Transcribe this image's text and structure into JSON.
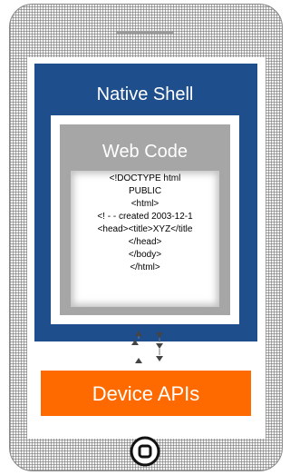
{
  "native_shell": {
    "label": "Native Shell",
    "color": "#1f4e8c"
  },
  "web_code": {
    "label": "Web Code",
    "color": "#a6a6a6",
    "code_lines": [
      "<!DOCTYPE html",
      "PUBLIC",
      "<html>",
      "<! - - created 2003-12-1",
      "<head><title>XYZ</title",
      "</head>",
      "</body>",
      "</html>"
    ]
  },
  "device_apis": {
    "label": "Device APIs",
    "color": "#ff6a00"
  },
  "icons": {
    "connector": "bidirectional-arrows-icon",
    "home": "home-button-icon",
    "speaker": "speaker-slot-icon"
  }
}
